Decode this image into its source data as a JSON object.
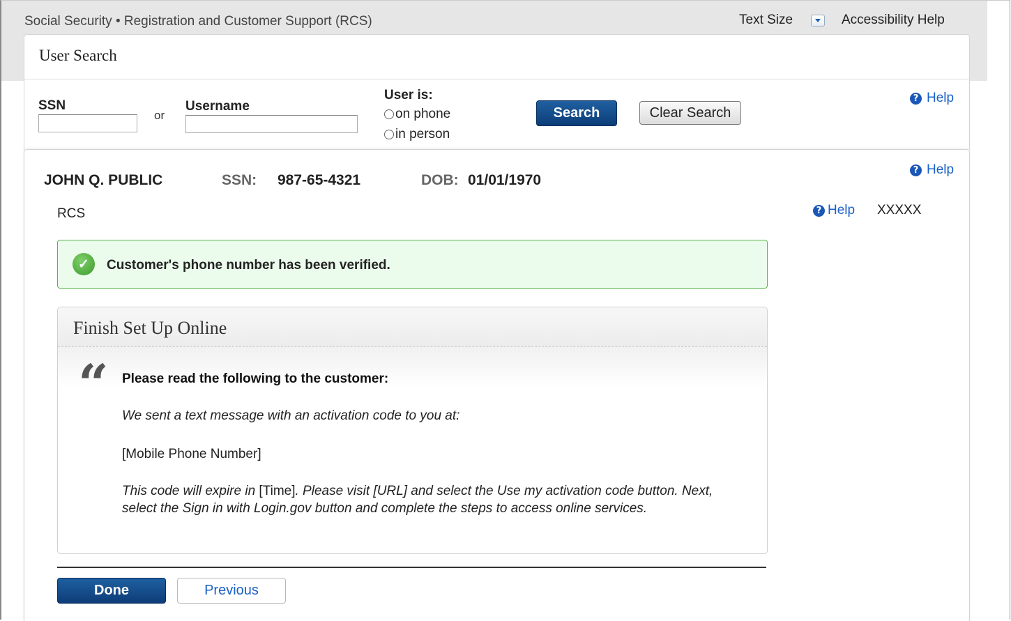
{
  "header": {
    "app_title": "Social Security • Registration and Customer Support (RCS)",
    "text_size_label": "Text Size",
    "accessibility_help": "Accessibility Help"
  },
  "user_search": {
    "title": "User Search",
    "ssn_label": "SSN",
    "ssn_value": "",
    "or_label": "or",
    "username_label": "Username",
    "username_value": "",
    "user_is_label": "User is:",
    "radio_on_phone": "on phone",
    "radio_in_person": "in person",
    "search_button": "Search",
    "clear_button": "Clear Search",
    "help": "Help"
  },
  "customer": {
    "name": "JOHN Q. PUBLIC",
    "ssn_label": "SSN:",
    "ssn": "987-65-4321",
    "dob_label": "DOB:",
    "dob": "01/01/1970",
    "help": "Help",
    "section": "RCS",
    "inner_help": "Help",
    "code": "XXXXX"
  },
  "alert": {
    "message": "Customer's phone number has been verified.",
    "color": "#58b34a"
  },
  "finish_setup": {
    "title": "Finish Set Up Online",
    "quote_glyph": "“",
    "read_heading": "Please read the following to the customer:",
    "line1": "We sent a text message with an activation code to you at:",
    "line2": "[Mobile Phone Number]",
    "line3_part1": "This code will expire in ",
    "line3_time": "[Time]",
    "line3_part2": ". Please visit [URL] and select the Use my activation code button. Next, select the Sign in with Login.gov button and complete the steps to access online services."
  },
  "actions": {
    "done": "Done",
    "previous": "Previous"
  },
  "colors": {
    "primary_button": "#0d3d78",
    "link": "#1a5fc8",
    "help_icon": "#1a57b8"
  }
}
